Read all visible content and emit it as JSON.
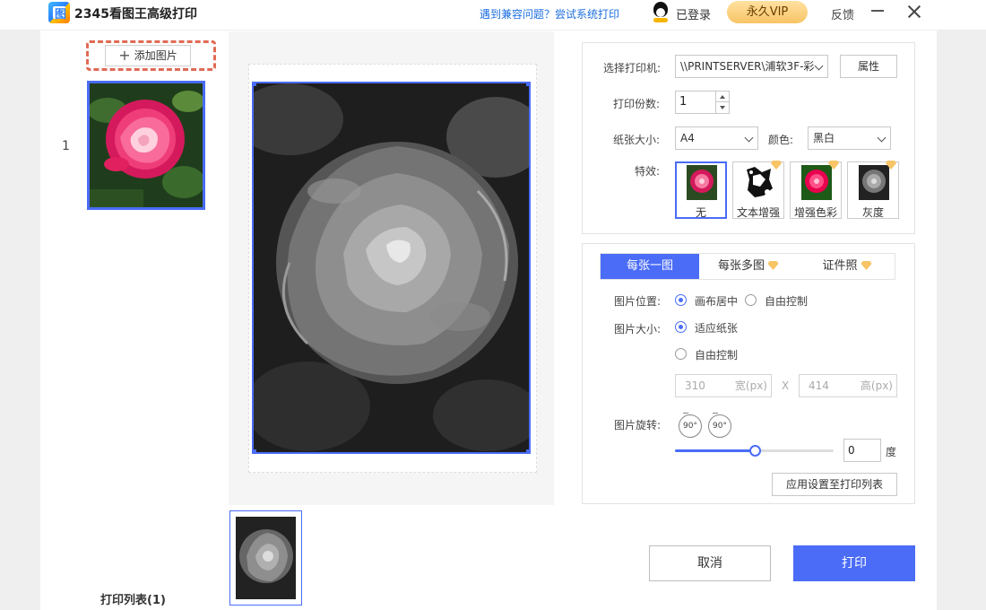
{
  "app": {
    "title": "2345看图王高级打印",
    "icon_glyph": "图",
    "compat_link": "遇到兼容问题？尝试系统打印",
    "logged_in_label": "已登录",
    "vip_label": "永久VIP",
    "feedback_label": "反馈"
  },
  "left_panel": {
    "add_image_label": "添加图片",
    "thumb_number": "1",
    "print_list_label": "打印列表(1)"
  },
  "settings": {
    "printer_label": "选择打印机:",
    "printer_value": "\\\\PRINTSERVER\\浦软3F-彩",
    "properties_button": "属性",
    "copies_label": "打印份数:",
    "copies_value": "1",
    "paper_size_label": "纸张大小:",
    "paper_size_value": "A4",
    "color_label": "颜色:",
    "color_value": "黑白",
    "effects_label": "特效:",
    "effects": [
      {
        "label": "无",
        "selected": true,
        "vip": false
      },
      {
        "label": "文本增强",
        "selected": false,
        "vip": true
      },
      {
        "label": "增强色彩",
        "selected": false,
        "vip": true
      },
      {
        "label": "灰度",
        "selected": false,
        "vip": true
      }
    ]
  },
  "layout": {
    "tabs": [
      {
        "label": "每张一图",
        "active": true,
        "vip": false
      },
      {
        "label": "每张多图",
        "active": false,
        "vip": true
      },
      {
        "label": "证件照",
        "active": false,
        "vip": true
      }
    ],
    "position_label": "图片位置:",
    "position_options": [
      {
        "label": "画布居中",
        "checked": true
      },
      {
        "label": "自由控制",
        "checked": false
      }
    ],
    "size_label": "图片大小:",
    "size_options": [
      {
        "label": "适应纸张",
        "checked": true
      },
      {
        "label": "自由控制",
        "checked": false
      }
    ],
    "width_value": "310",
    "width_unit": "宽(px)",
    "times_sign": "X",
    "height_value": "414",
    "height_unit": "高(px)",
    "rotate_label": "图片旋转:",
    "rotate_left_label": "90°",
    "rotate_right_label": "90°",
    "rotation_value": "0",
    "rotation_unit": "度",
    "rotation_slider_fraction": 0.5,
    "apply_button": "应用设置至打印列表"
  },
  "actions": {
    "cancel": "取消",
    "print": "打印"
  },
  "colors": {
    "accent": "#4a6cf7",
    "vip_gold": "#f7c466",
    "dashed_highlight": "#e06a55"
  }
}
